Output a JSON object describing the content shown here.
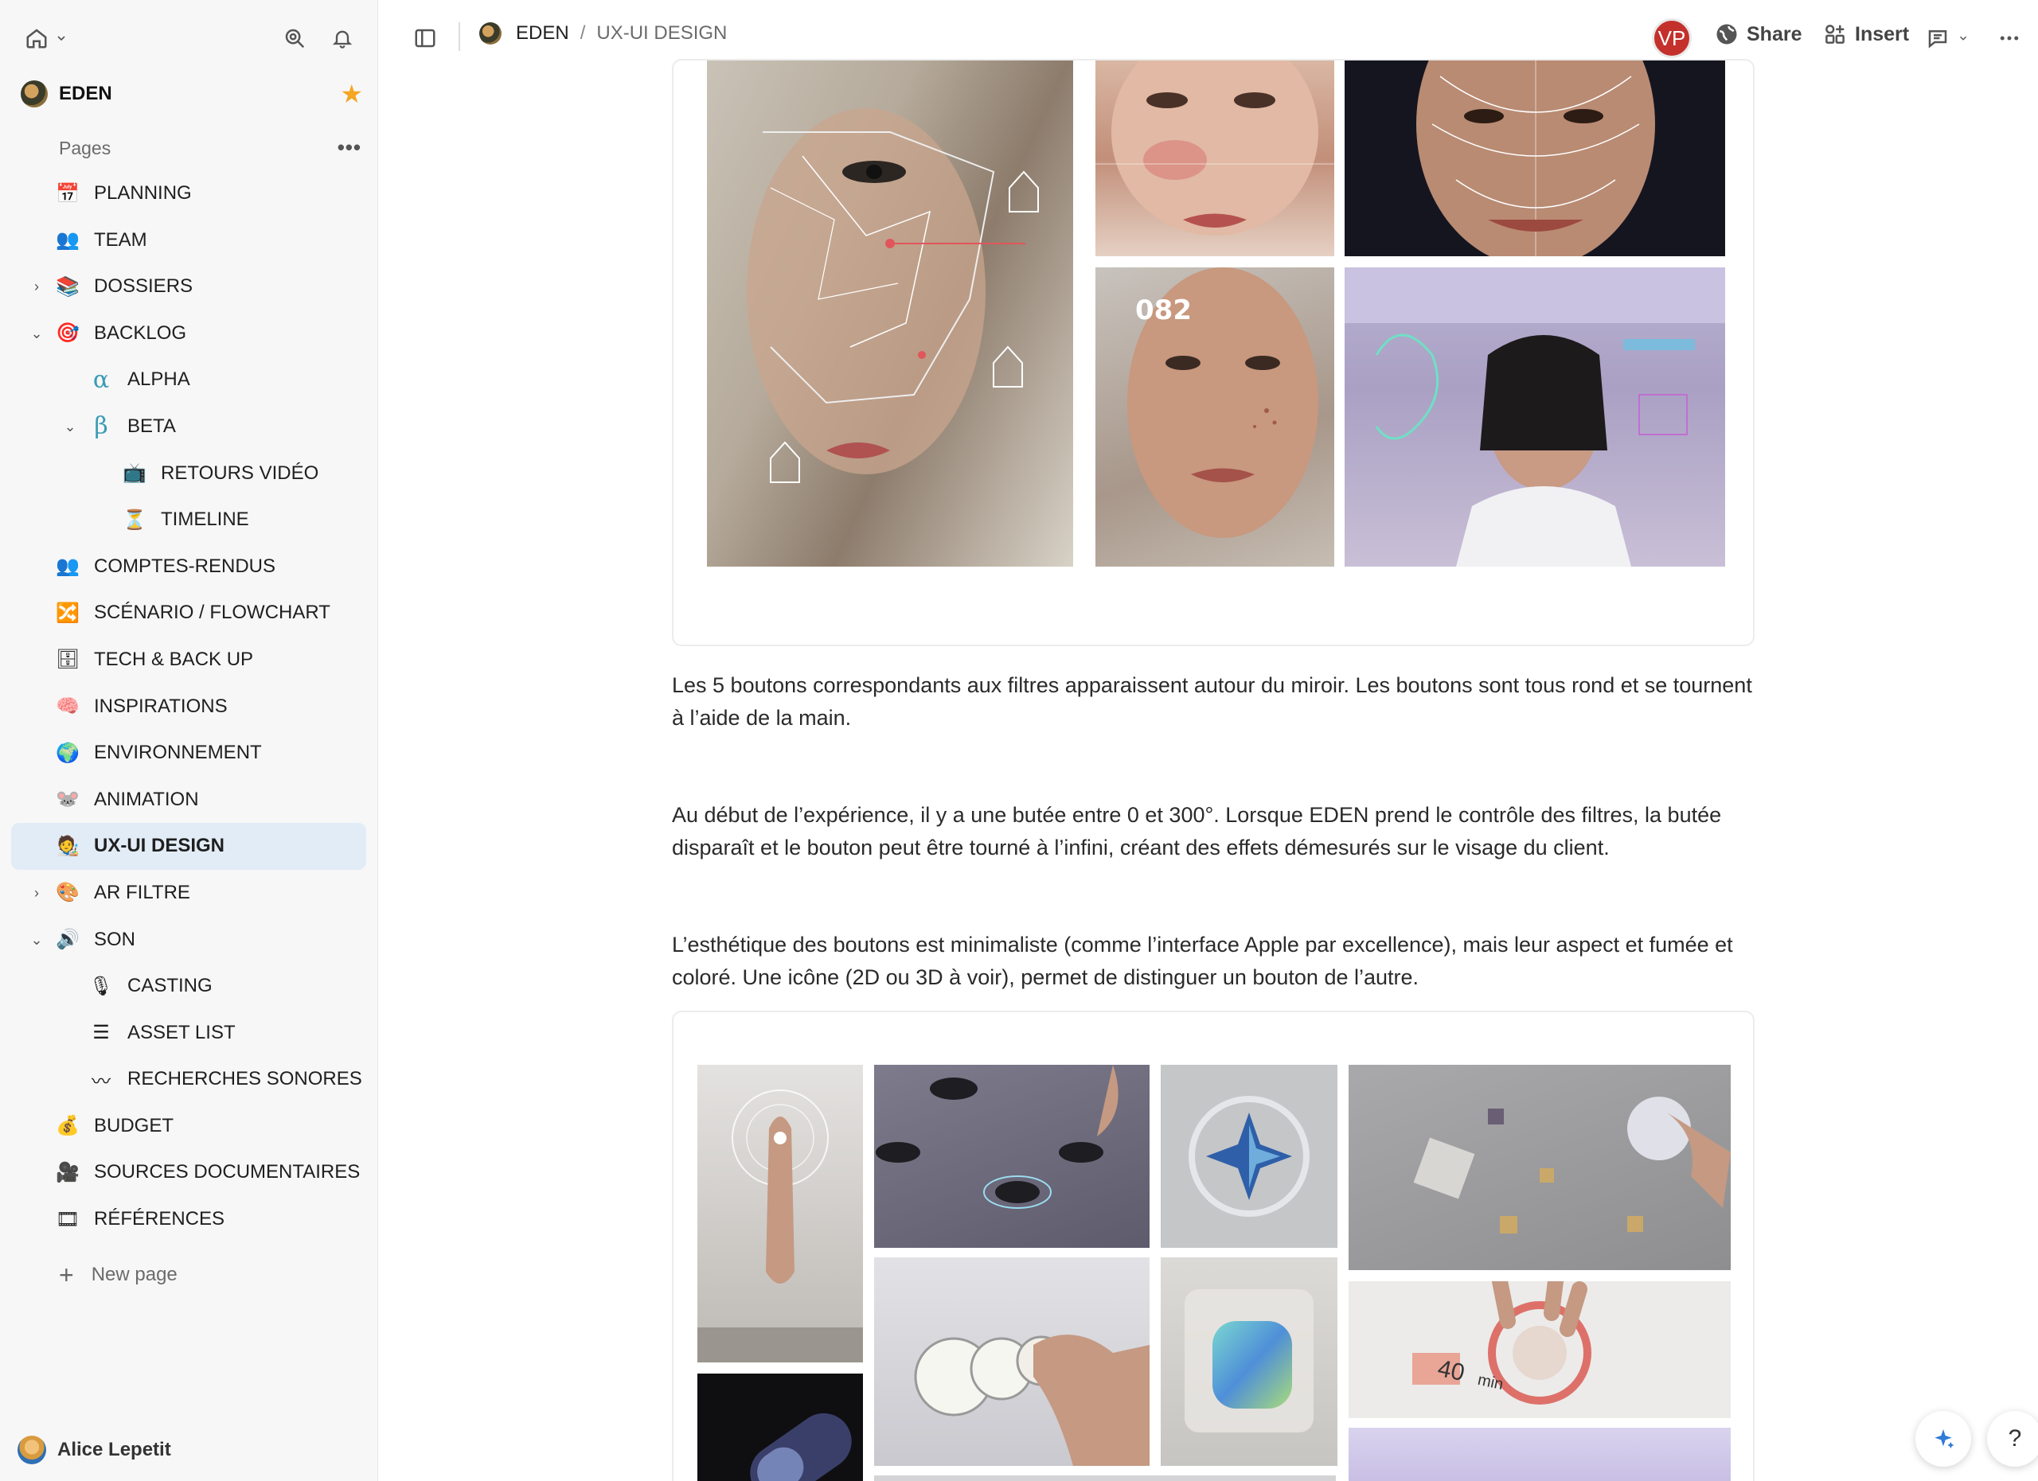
{
  "workspace": {
    "name": "EDEN"
  },
  "sidebar": {
    "pages_label": "Pages",
    "new_page_label": "New page",
    "items": [
      {
        "label": "PLANNING",
        "emoji": "📅",
        "level": 0,
        "chevron": ""
      },
      {
        "label": "TEAM",
        "emoji": "👥",
        "level": 0,
        "chevron": ""
      },
      {
        "label": "DOSSIERS",
        "emoji": "📚",
        "level": 0,
        "chevron": "›"
      },
      {
        "label": "BACKLOG",
        "emoji": "🎯",
        "level": 0,
        "chevron": "⌄"
      },
      {
        "label": "ALPHA",
        "emoji": "α",
        "level": 1,
        "chevron": ""
      },
      {
        "label": "BETA",
        "emoji": "β",
        "level": 1,
        "chevron": "⌄"
      },
      {
        "label": "RETOURS VIDÉO",
        "emoji": "📺",
        "level": 2,
        "chevron": ""
      },
      {
        "label": "TIMELINE",
        "emoji": "⏳",
        "level": 2,
        "chevron": ""
      },
      {
        "label": "COMPTES-RENDUS",
        "emoji": "👥",
        "level": 0,
        "chevron": ""
      },
      {
        "label": "SCÉNARIO / FLOWCHART",
        "emoji": "🔀",
        "level": 0,
        "chevron": ""
      },
      {
        "label": "TECH & BACK UP",
        "emoji": "🗄",
        "level": 0,
        "chevron": ""
      },
      {
        "label": "INSPIRATIONS",
        "emoji": "🧠",
        "level": 0,
        "chevron": ""
      },
      {
        "label": "ENVIRONNEMENT",
        "emoji": "🌍",
        "level": 0,
        "chevron": ""
      },
      {
        "label": "ANIMATION",
        "emoji": "🐭",
        "level": 0,
        "chevron": ""
      },
      {
        "label": "UX-UI DESIGN",
        "emoji": "🧑‍🎨",
        "level": 0,
        "chevron": "",
        "active": true
      },
      {
        "label": "AR FILTRE",
        "emoji": "🎨",
        "level": 0,
        "chevron": "›"
      },
      {
        "label": "SON",
        "emoji": "🔊",
        "level": 0,
        "chevron": "⌄"
      },
      {
        "label": "CASTING",
        "emoji": "🎙",
        "level": 1,
        "chevron": ""
      },
      {
        "label": "ASSET LIST",
        "emoji": "☰",
        "level": 1,
        "chevron": ""
      },
      {
        "label": "RECHERCHES SONORES",
        "emoji": "〰",
        "level": 1,
        "chevron": ""
      },
      {
        "label": "BUDGET",
        "emoji": "💰",
        "level": 0,
        "chevron": ""
      },
      {
        "label": "SOURCES DOCUMENTAIRES",
        "emoji": "🎥",
        "level": 0,
        "chevron": ""
      },
      {
        "label": "RÉFÉRENCES",
        "emoji": "🎞",
        "level": 0,
        "chevron": ""
      }
    ],
    "user": {
      "name": "Alice Lepetit"
    }
  },
  "topbar": {
    "breadcrumb": [
      "EDEN",
      "UX-UI DESIGN"
    ],
    "breadcrumb_sep": "/",
    "avatar_initials": "VP",
    "share_label": "Share",
    "insert_label": "Insert"
  },
  "content": {
    "paragraphs": [
      "Les 5 boutons correspondants aux filtres apparaissent autour du miroir. Les boutons sont tous rond et se tournent à l’aide de la main.",
      "Au début de l’expérience, il y a une butée entre 0 et 300°. Lorsque EDEN prend le contrôle des filtres, la butée disparaît et le bouton peut être tourné à l’infini, créant des effets démesurés sur le visage du client.",
      "L’esthétique des boutons est minimaliste (comme l’interface Apple par excellence), mais leur aspect et fumée et coloré. Une icône (2D ou 3D à voir), permet de distinguer un bouton de l’autre."
    ],
    "gallery1": {
      "image_texts": [
        "082"
      ]
    },
    "gallery2": {
      "image_texts": [
        "40",
        "min"
      ]
    }
  },
  "fab": {
    "help_label": "?"
  },
  "colors": {
    "accent": "#2f7bd8",
    "active_bg": "#e2ecf6",
    "avatar_red": "#c4302b",
    "star": "#f5a623"
  }
}
